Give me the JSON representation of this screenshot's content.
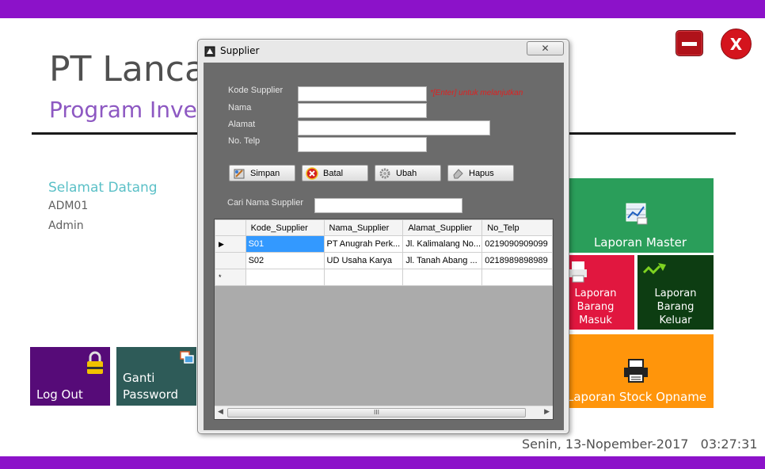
{
  "app": {
    "company": "PT Lanca",
    "program": "Program Inven",
    "welcome": "Selamat Datang",
    "user_id": "ADM01",
    "user_role": "Admin",
    "datetime": "Senin, 13-Nopember-2017   03:27:31"
  },
  "window_controls": {
    "close_label": "X"
  },
  "tiles": {
    "logout": "Log Out",
    "ganti_password": "Ganti Password",
    "laporan_master": "Laporan Master",
    "laporan_masuk": "Laporan Barang Masuk",
    "laporan_keluar": "Laporan Barang Keluar",
    "laporan_opname": "Laporan Stock Opname"
  },
  "dialog": {
    "title": "Supplier",
    "close_glyph": "✕",
    "fields": {
      "kode": {
        "label": "Kode Supplier",
        "value": ""
      },
      "nama": {
        "label": "Nama",
        "value": ""
      },
      "alamat": {
        "label": "Alamat",
        "value": ""
      },
      "telp": {
        "label": "No. Telp",
        "value": ""
      }
    },
    "hint": "*[Enter] untuk melanjutkan",
    "buttons": {
      "simpan": "Simpan",
      "batal": "Batal",
      "ubah": "Ubah",
      "hapus": "Hapus"
    },
    "search": {
      "label": "Cari Nama Supplier",
      "value": ""
    },
    "grid": {
      "columns": [
        "Kode_Supplier",
        "Nama_Supplier",
        "Alamat_Supplier",
        "No_Telp"
      ],
      "rows": [
        [
          "S01",
          "PT Anugrah Perk...",
          "Jl. Kalimalang No...",
          "0219090909099"
        ],
        [
          "S02",
          "UD Usaha Karya",
          "Jl. Tanah Abang ...",
          "0218989898989"
        ]
      ],
      "current_row_marker": "▶",
      "new_row_marker": "*",
      "scroll_left": "◀",
      "scroll_right": "▶",
      "scroll_grip": "III"
    }
  },
  "colors": {
    "accent_purple": "#8c12c9",
    "tile_logout": "#560b78",
    "tile_ganti": "#2e5b58",
    "tile_master": "#2a9e5a",
    "tile_masuk": "#e1173f",
    "tile_keluar": "#0d3d12",
    "tile_opname": "#ff950b"
  }
}
